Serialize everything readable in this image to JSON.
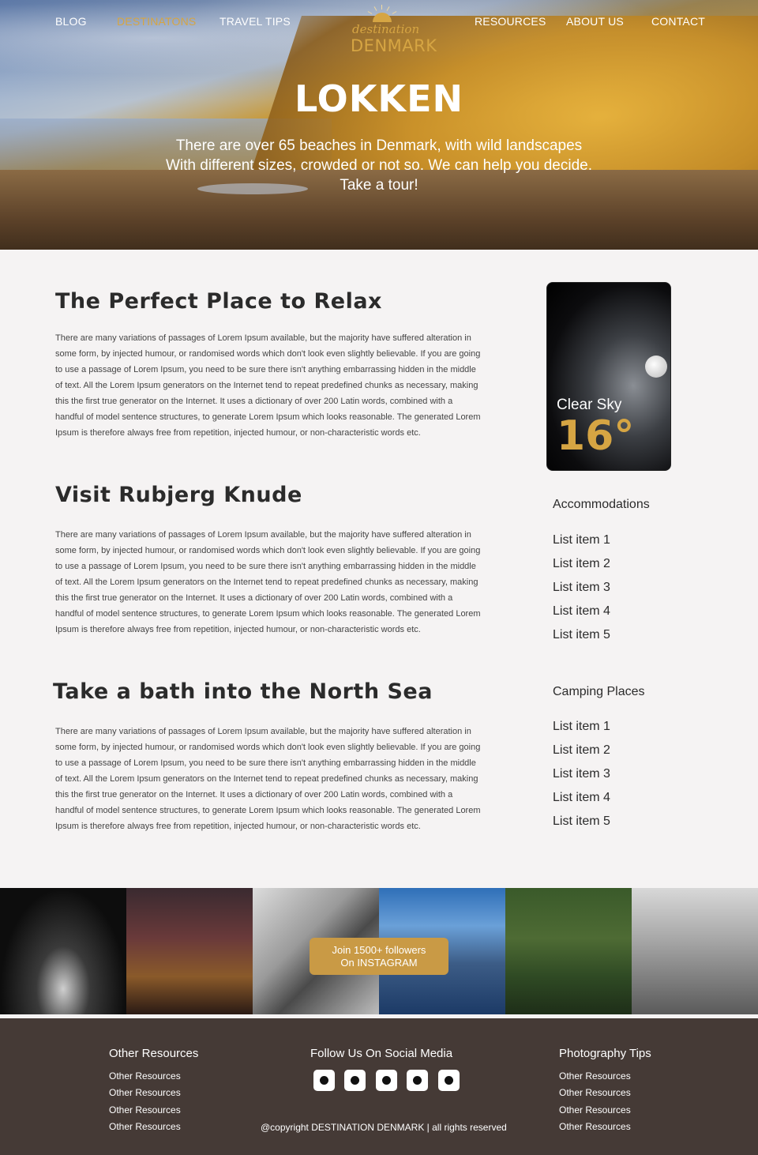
{
  "nav": {
    "left": [
      "BLOG",
      "DESTINATONS",
      "TRAVEL TIPS"
    ],
    "right": [
      "RESOURCES",
      "ABOUT US",
      "CONTACT"
    ],
    "active_color": "#d6a543"
  },
  "logo": {
    "script": "destination",
    "brand": "DENMARK"
  },
  "hero": {
    "title": "LOKKEN",
    "lines": [
      "There are over 65 beaches in Denmark, with wild landscapes",
      "With different sizes, crowded or not so. We can help you decide.",
      "Take a tour!"
    ]
  },
  "sections": [
    {
      "title": "The Perfect Place to Relax",
      "body": "There are many variations of passages of Lorem Ipsum available, but the majority have suffered alteration in some form, by injected humour, or randomised words which don't look even slightly believable. If you are going to use a passage of Lorem Ipsum, you need to be sure there isn't anything embarrassing hidden in the middle of text. All the Lorem Ipsum generators on the Internet tend to repeat predefined chunks as necessary, making this the first true generator on the Internet. It uses a dictionary of over 200 Latin words, combined with a handful of model sentence structures, to generate Lorem Ipsum which looks reasonable. The generated Lorem Ipsum is therefore always free from repetition, injected humour, or non-characteristic words etc."
    },
    {
      "title": "Visit Rubjerg Knude",
      "body": "There are many variations of passages of Lorem Ipsum available, but the majority have suffered alteration in some form, by injected humour, or randomised words which don't look even slightly believable. If you are going to use a passage of Lorem Ipsum, you need to be sure there isn't anything embarrassing hidden in the middle of text. All the Lorem Ipsum generators on the Internet tend to repeat predefined chunks as necessary, making this the first true generator on the Internet. It uses a dictionary of over 200 Latin words, combined with a handful of model sentence structures, to generate Lorem Ipsum which looks reasonable. The generated Lorem Ipsum is therefore always free from repetition, injected humour, or non-characteristic words etc."
    },
    {
      "title": "Take a bath into the North Sea",
      "body": "There are many variations of passages of Lorem Ipsum available, but the majority have suffered alteration in some form, by injected humour, or randomised words which don't look even slightly believable. If you are going to use a passage of Lorem Ipsum, you need to be sure there isn't anything embarrassing hidden in the middle of text. All the Lorem Ipsum generators on the Internet tend to repeat predefined chunks as necessary, making this the first true generator on the Internet. It uses a dictionary of over 200 Latin words, combined with a handful of model sentence structures, to generate Lorem Ipsum which looks reasonable. The generated Lorem Ipsum is therefore always free from repetition, injected humour, or non-characteristic words etc."
    }
  ],
  "weather": {
    "condition": "Clear Sky",
    "temperature": "16°",
    "icon": "moon-icon"
  },
  "sidebar": {
    "accommodations": {
      "title": "Accommodations",
      "items": [
        "List item 1",
        "List item 2",
        "List item 3",
        "List item 4",
        "List item 5"
      ]
    },
    "camping": {
      "title": "Camping Places",
      "items": [
        "List item 1",
        "List item 2",
        "List item 3",
        "List item 4",
        "List item 5"
      ]
    }
  },
  "instagram": {
    "cta_line1": "Join 1500+ followers",
    "cta_line2": "On INSTAGRAM",
    "button_color": "#c99a45"
  },
  "footer": {
    "left": {
      "title": "Other Resources",
      "links": [
        "Other Resources",
        "Other Resources",
        "Other Resources",
        "Other Resources"
      ]
    },
    "center": {
      "title": "Follow Us On Social Media",
      "icons": [
        "social-icon-1",
        "social-icon-2",
        "social-icon-3",
        "social-icon-4",
        "social-icon-5"
      ]
    },
    "right": {
      "title": "Photography Tips",
      "links": [
        "Other Resources",
        "Other Resources",
        "Other Resources",
        "Other Resources"
      ]
    },
    "copyright": "@copyright DESTINATION DENMARK | all rights reserved",
    "background": "#453a36"
  }
}
